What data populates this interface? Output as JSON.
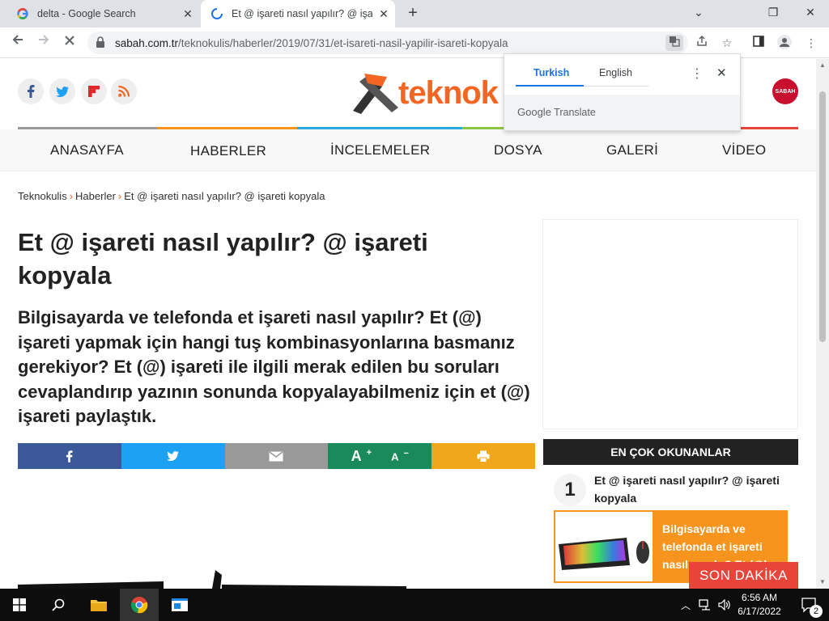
{
  "browser": {
    "tabs": [
      {
        "title": "delta - Google Search",
        "close": "✕"
      },
      {
        "title": "Et @ işareti nasıl yapılır? @ işareti kopyala",
        "close": "✕"
      }
    ],
    "new_tab": "+",
    "window": {
      "minimize": "⌄",
      "restore": "❐",
      "close": "✕"
    },
    "url_domain": "sabah.com.tr",
    "url_path": "/teknokulis/haberler/2019/07/31/et-isareti-nasil-yapilir-isareti-kopyala"
  },
  "translate_popup": {
    "lang_from": "Turkish",
    "lang_to": "English",
    "more": "⋮",
    "close": "✕",
    "footer_google": "Google",
    "footer_translate": "Translate"
  },
  "site": {
    "logo_text": "teknok",
    "sabah_badge": "SABAH",
    "social": [
      {
        "glyph": "f",
        "color": "#3b5998"
      },
      {
        "glyph": "t",
        "color": "#1da1f2"
      },
      {
        "glyph": "F",
        "color": "#e1252b"
      },
      {
        "glyph": "rss",
        "color": "#f26522"
      }
    ],
    "nav": [
      "ANASAYFA",
      "HABERLER",
      "İNCELEMELER",
      "DOSYA",
      "GALERİ",
      "VİDEO"
    ],
    "nav_colors": [
      "#999999",
      "#f7941d",
      "#29abe2",
      "#8dc63f",
      "#8e44ad",
      "#e8443a"
    ]
  },
  "breadcrumb": [
    "Teknokulis",
    "Haberler",
    "Et @ işareti nasıl yapılır? @ işareti kopyala"
  ],
  "article": {
    "headline": "Et @ işareti nasıl yapılır? @ işareti kopyala",
    "summary": "Bilgisayarda ve telefonda et işareti nasıl yapılır? Et (@) işareti yapmak için hangi tuş kombinasyonlarına basmanız gerekiyor? Et (@) işareti ile ilgili merak edilen bu soruları cevaplandırıp yazının sonunda kopyalayabilmeniz için et (@) işareti paylaştık."
  },
  "share": {
    "font_up": "A",
    "font_down": "A",
    "plus": "+",
    "minus": "−",
    "colors": [
      "#3b5998",
      "#1da1f2",
      "#999999",
      "#1b8a5a",
      "#f0a71a"
    ]
  },
  "popular": {
    "heading": "EN ÇOK OKUNANLAR",
    "rank": "1",
    "title": "Et @ işareti nasıl yapılır? @ işareti kopyala",
    "card_text": "Bilgisayarda ve telefonda et işareti nasıl yapılır? Et (@)"
  },
  "son_dakika": "SON DAKİKA",
  "taskbar": {
    "time": "6:56 AM",
    "date": "6/17/2022",
    "notifications": "2"
  }
}
